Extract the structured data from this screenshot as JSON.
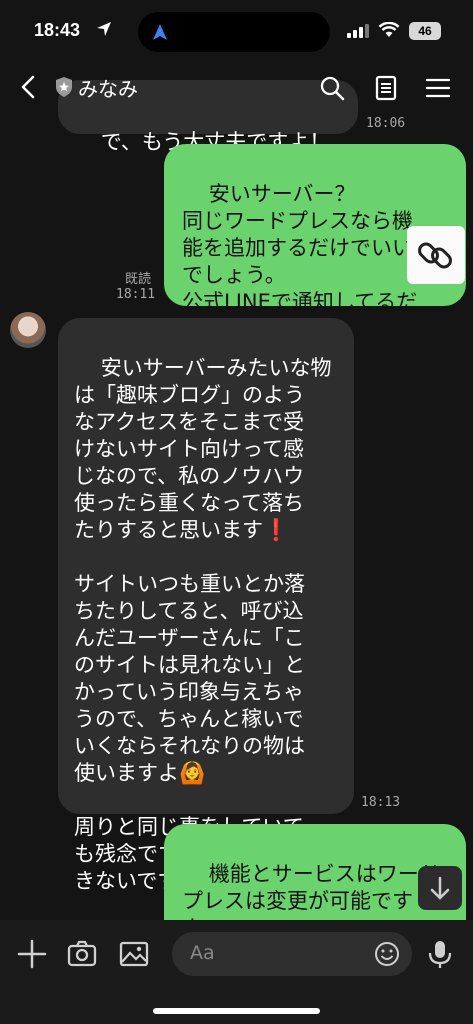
{
  "status_bar": {
    "time": "18:43",
    "battery": "46"
  },
  "header": {
    "contact_name": "みなみ"
  },
  "messages": {
    "m0_text": "で、もう大丈夫ですよ！",
    "m0_time": "18:06",
    "m1_text": "安いサーバー？\n同じワードプレスなら機\n能を追加するだけでいい\nでしょう。\n公式LINEで通知してるだ\nけですよね。",
    "m1_read": "既読",
    "m1_time": "18:11",
    "m2_text": "安いサーバーみたいな物\nは「趣味ブログ」のよう\nなアクセスをそこまで受\nけないサイト向けって感\nじなので、私のノウハウ\n使ったら重くなって落ち\nたりすると思います❗\n\nサイトいつも重いとか落\nちたりしてると、呼び込\nんだユーザーさんに「こ\nのサイトは見れない」と\nかっていう印象与えちゃ\nうので、ちゃんと稼いで\nいくならそれなりの物は\n使いますよ🙆\n\n周りと同じ事をしていて\nも残念ですが稼ぐ事はで\nきないです❗",
    "m2_time": "18:13",
    "m3_text": "機能とサービスはワード\nプレスは変更が可能です\nよ。\n自分のサイトから申し込"
  },
  "input": {
    "placeholder": "Aa"
  },
  "colors": {
    "outgoing": "#6ad36d",
    "incoming": "#2e2e2e",
    "background": "#141414"
  },
  "icons": [
    "back-icon",
    "shield-icon",
    "search-icon",
    "notes-icon",
    "menu-icon",
    "link-icon",
    "scroll-down-icon",
    "plus-icon",
    "camera-icon",
    "image-icon",
    "emoji-icon",
    "mic-icon"
  ]
}
